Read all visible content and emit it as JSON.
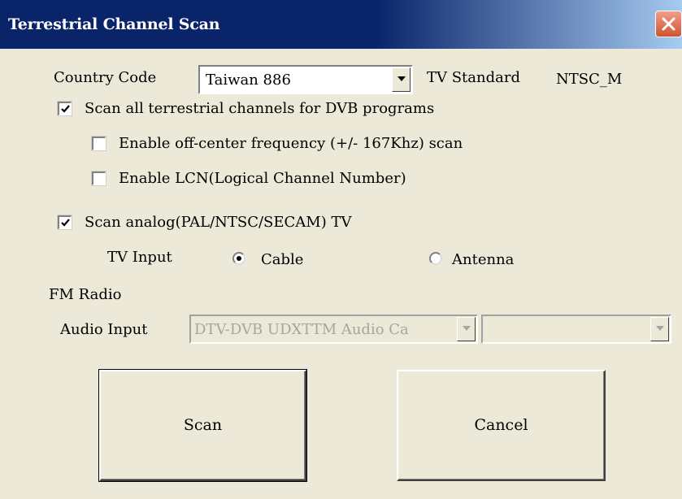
{
  "window": {
    "title": "Terrestrial Channel Scan"
  },
  "country": {
    "label": "Country Code",
    "value": "Taiwan  886"
  },
  "tv_standard": {
    "label": "TV Standard",
    "value": "NTSC_M"
  },
  "dvb": {
    "scan_all_label": "Scan all terrestrial channels for DVB programs",
    "scan_all_checked": true,
    "off_center_label": "Enable off-center frequency (+/- 167Khz) scan",
    "off_center_checked": false,
    "lcn_label": "Enable LCN(Logical Channel Number)",
    "lcn_checked": false
  },
  "analog": {
    "scan_label": "Scan analog(PAL/NTSC/SECAM) TV",
    "scan_checked": true,
    "tv_input_label": "TV Input",
    "cable_label": "Cable",
    "cable_selected": true,
    "antenna_label": "Antenna",
    "antenna_selected": false
  },
  "fm": {
    "label": "FM Radio",
    "audio_input_label": "Audio Input",
    "audio_input_value": "DTV-DVB UDXTTM Audio Ca",
    "audio_input2_value": ""
  },
  "buttons": {
    "scan": "Scan",
    "cancel": "Cancel"
  },
  "colors": {
    "titlebar": "#0a246a",
    "face": "#ece9d8",
    "close": "#d0522f"
  }
}
